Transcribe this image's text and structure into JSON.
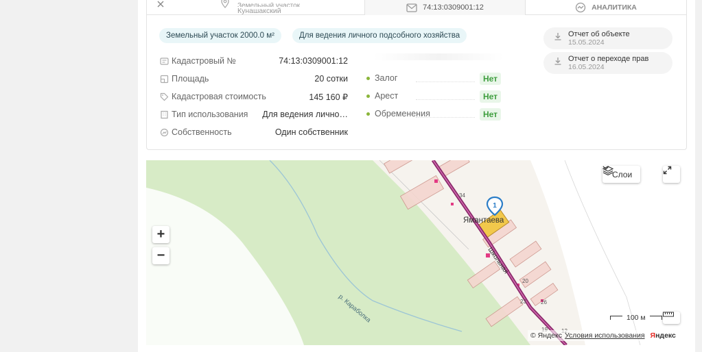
{
  "tabs": {
    "land_title": "Земельный участок",
    "land_subtitle": "Кунашакский",
    "cadastral": "74:13:0309001:12",
    "analytics": "АНАЛИТИКА"
  },
  "chips": [
    "Земельный участок 2000.0 м²",
    "Для ведения личного подсобного хозяйства"
  ],
  "details": [
    {
      "label": "Кадастровый №",
      "value": "74:13:0309001:12"
    },
    {
      "label": "Площадь",
      "value": "20 сотки"
    },
    {
      "label": "Кадастровая стоимость",
      "value": "145 160 ₽"
    },
    {
      "label": "Тип использования",
      "value": "Для ведения лично…"
    },
    {
      "label": "Собственность",
      "value": "Один собственник"
    }
  ],
  "restrictions": [
    {
      "label": "Залог",
      "value": "Нет"
    },
    {
      "label": "Арест",
      "value": "Нет"
    },
    {
      "label": "Обременения",
      "value": "Нет"
    }
  ],
  "reports": [
    {
      "title": "Отчет об объекте",
      "date": "15.05.2024"
    },
    {
      "title": "Отчет о переходе прав",
      "date": "16.05.2024"
    }
  ],
  "map": {
    "zoom_in": "+",
    "zoom_out": "−",
    "layers_label": "Слои",
    "scale_label": "100 м",
    "copyright": "© Яндекс",
    "terms": "Условия использования",
    "logo_red": "Я",
    "logo_rest": "ндекс",
    "marker_number": "1",
    "village_label": "Ямантаева",
    "street_label": "Школьная",
    "river_label": "р. Караболка",
    "house_numbers": [
      "34",
      "20",
      "23",
      "19",
      "12",
      "26"
    ]
  },
  "colors": {
    "accent_chip_bg": "#e9f6f8",
    "ok_green": "#3e9e3e",
    "map_green": "#d7ebc6",
    "road": "#8b2a6b",
    "marker": "#2a7cc7"
  }
}
